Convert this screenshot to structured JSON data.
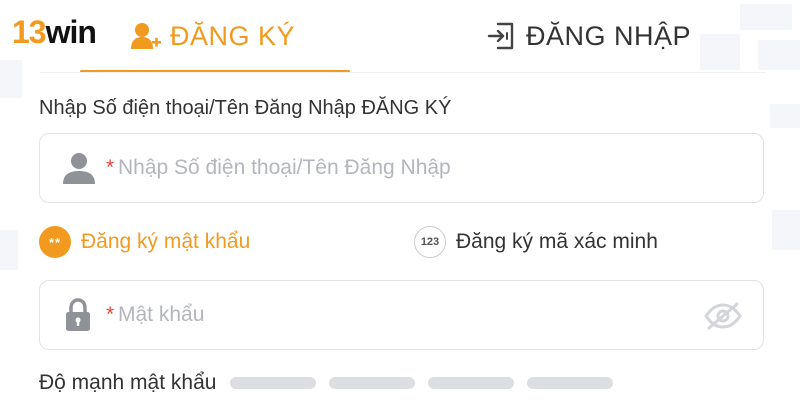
{
  "logo": {
    "number": "13",
    "word": "win"
  },
  "tabs": [
    {
      "label": "ĐĂNG KÝ",
      "icon": "add-user-icon",
      "active": true
    },
    {
      "label": "ĐĂNG NHẬP",
      "icon": "login-icon",
      "active": false
    }
  ],
  "form": {
    "username_label": "Nhập Số điện thoại/Tên Đăng Nhập ĐĂNG KÝ",
    "username_placeholder": "Nhập Số điện thoại/Tên Đăng Nhập",
    "username_value": "",
    "required_marker": "*",
    "password_placeholder": "Mật khẩu",
    "password_value": ""
  },
  "methods": [
    {
      "badge": "**",
      "label": "Đăng ký mật khẩu",
      "active": true
    },
    {
      "badge": "123",
      "label": "Đăng ký mã xác minh",
      "active": false
    }
  ],
  "strength": {
    "label": "Độ mạnh mật khẩu",
    "level": 0,
    "max_level": 4
  },
  "colors": {
    "accent": "#f29a1f",
    "required": "#e8463a",
    "inactive_bar": "#dcdee2"
  }
}
